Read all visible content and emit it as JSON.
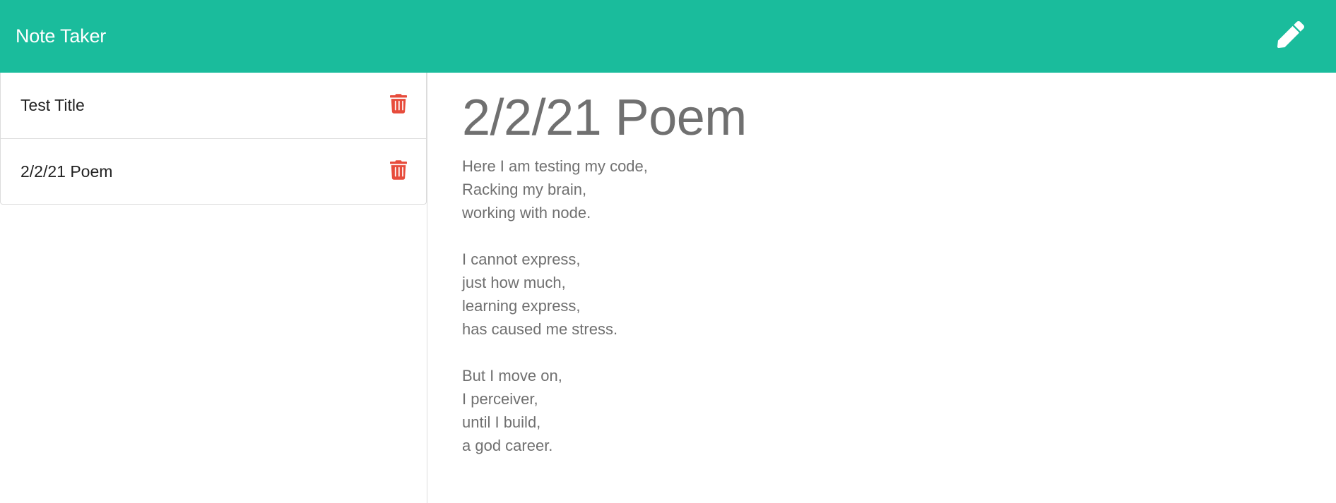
{
  "navbar": {
    "brand": "Note Taker",
    "new_note_icon": "pencil-icon",
    "background": "#1abc9c"
  },
  "notes": [
    {
      "title": "Test Title",
      "delete_icon": "trash-icon"
    },
    {
      "title": "2/2/21 Poem",
      "delete_icon": "trash-icon"
    }
  ],
  "active_note": {
    "title": "2/2/21 Poem",
    "text": "Here I am testing my code,\nRacking my brain,\nworking with node.\n\nI cannot express,\njust how much,\nlearning express,\nhas caused me stress.\n\nBut I move on,\nI perceiver,\nuntil I build,\na god career."
  },
  "colors": {
    "accent": "#1abc9c",
    "delete": "#e74c3c",
    "note_text": "#707070"
  }
}
